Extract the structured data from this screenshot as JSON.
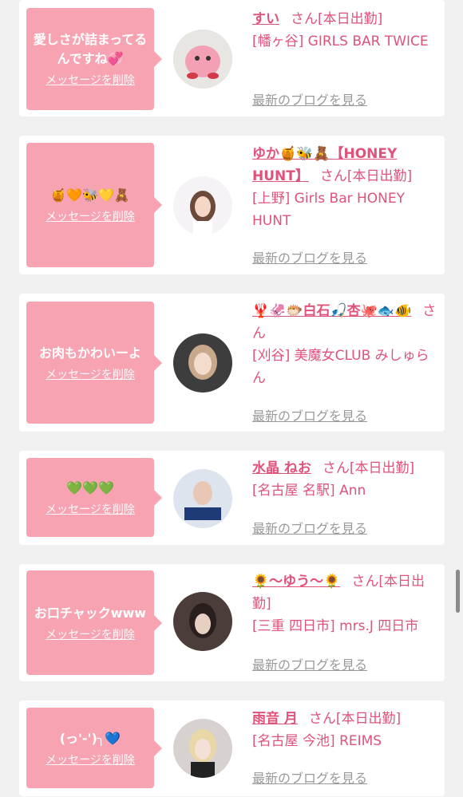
{
  "delete_label": "メッセージを削除",
  "blog_label": "最新のブログを見る",
  "san_label": "さん",
  "entries": [
    {
      "message": "愛しさが詰まってるんですね💞",
      "name": "すい",
      "status": "[本日出勤]",
      "shop": "[幡ヶ谷] GIRLS BAR TWICE",
      "avatar_icon": "pink-plush-icon"
    },
    {
      "message": "🍯🧡🐝💛🧸",
      "name": "ゆか🍯🐝🧸【HONEY HUNT】",
      "status": "[本日出勤]",
      "shop": "[上野] Girls Bar HONEY HUNT",
      "avatar_icon": "girl-photo"
    },
    {
      "message": "お肉もかわいーよ",
      "name": "🦞🦑🐡白石🎣杏🐙🐟🐠",
      "status": "",
      "shop": "[刈谷] 美魔女CLUB みしゅらん",
      "avatar_icon": "girl-photo"
    },
    {
      "message": "💚💚💚",
      "name": "水晶 ねお",
      "status": "[本日出勤]",
      "shop": "[名古屋 名駅] Ann",
      "avatar_icon": "no1-photo"
    },
    {
      "message": "お口チャックwww",
      "name": "🌻〜ゆう〜🌻",
      "status": "[本日出勤]",
      "shop": "[三重 四日市] mrs.J 四日市",
      "avatar_icon": "girl-photo"
    },
    {
      "message": "(っ'-')╮💙",
      "name": "雨音 月",
      "status": "[本日出勤]",
      "shop": "[名古屋 今池] REIMS",
      "avatar_icon": "girl-photo"
    }
  ]
}
